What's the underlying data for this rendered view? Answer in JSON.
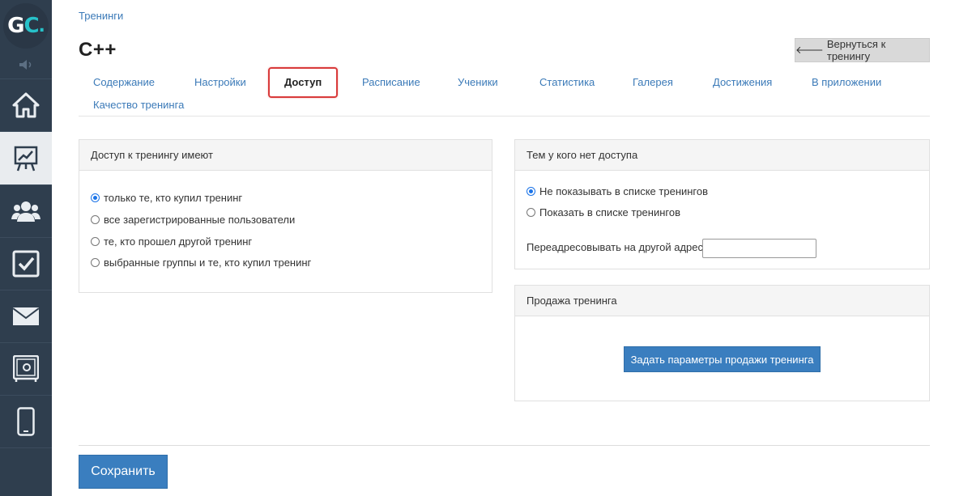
{
  "logo": {
    "g": "G",
    "c": "C",
    "dot": "."
  },
  "sidebar": {
    "items": [
      {
        "name": "home-icon"
      },
      {
        "name": "chart-board-icon",
        "active": true
      },
      {
        "name": "users-icon"
      },
      {
        "name": "checkbox-icon"
      },
      {
        "name": "mail-icon"
      },
      {
        "name": "safe-icon"
      },
      {
        "name": "mobile-icon"
      }
    ]
  },
  "breadcrumb": "Тренинги",
  "title": "C++",
  "back_button": {
    "arrow": "🡐",
    "label": "Вернуться к тренингу"
  },
  "tabs": [
    {
      "label": "Содержание"
    },
    {
      "label": "Настройки"
    },
    {
      "label": "Доступ",
      "active": true
    },
    {
      "label": "Расписание"
    },
    {
      "label": "Ученики"
    },
    {
      "label": "Статистика"
    },
    {
      "label": "Галерея"
    },
    {
      "label": "Достижения"
    },
    {
      "label": "В приложении"
    },
    {
      "label": "Качество тренинга"
    }
  ],
  "access_panel": {
    "title": "Доступ к тренингу имеют",
    "options": [
      {
        "label": "только те, кто купил тренинг",
        "checked": true
      },
      {
        "label": "все зарегистрированные пользователи",
        "checked": false
      },
      {
        "label": "те, кто прошел другой тренинг",
        "checked": false
      },
      {
        "label": "выбранные группы и те, кто купил тренинг",
        "checked": false
      }
    ]
  },
  "no_access_panel": {
    "title": "Тем у кого нет доступа",
    "options": [
      {
        "label": "Не показывать в списке тренингов",
        "checked": true
      },
      {
        "label": "Показать в списке тренингов",
        "checked": false
      }
    ],
    "redirect_label": "Переадресовывать на другой адрес",
    "redirect_value": ""
  },
  "sale_panel": {
    "title": "Продажа тренинга",
    "button_label": "Задать параметры продажи тренинга"
  },
  "save_label": "Сохранить",
  "colors": {
    "accent": "#3a7ebf",
    "link": "#3b7ab8",
    "sidebar": "#2f3e4e",
    "highlight": "#d93a3a"
  }
}
